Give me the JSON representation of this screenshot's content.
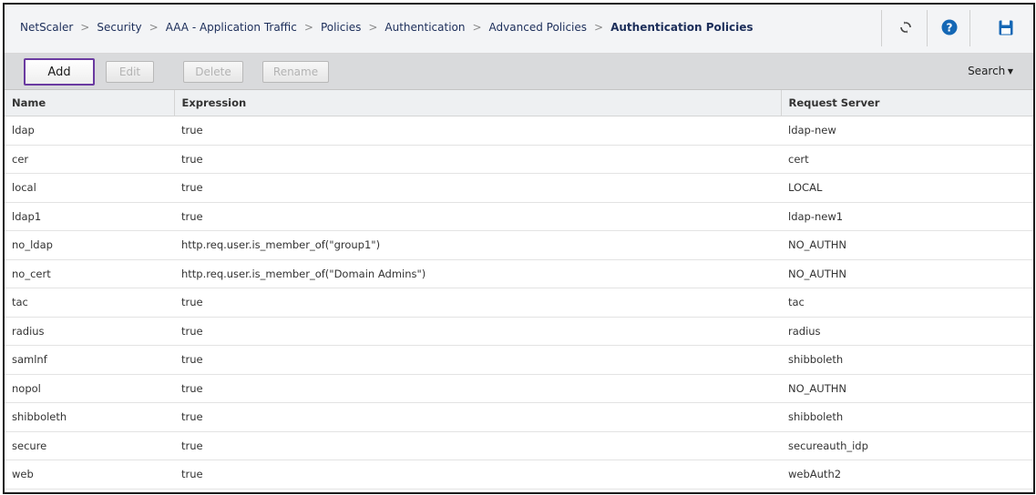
{
  "breadcrumb": [
    "NetScaler",
    "Security",
    "AAA - Application Traffic",
    "Policies",
    "Authentication",
    "Advanced Policies"
  ],
  "breadcrumb_current": "Authentication Policies",
  "header_icons": {
    "refresh": "refresh-icon",
    "help": "help-icon",
    "save": "save-icon"
  },
  "colors": {
    "accent": "#1c2e5a",
    "help_blue": "#1467b5",
    "add_border": "#6a3aa0"
  },
  "toolbar": {
    "add_label": "Add",
    "edit_label": "Edit",
    "delete_label": "Delete",
    "rename_label": "Rename",
    "search_label": "Search"
  },
  "table": {
    "columns": [
      "Name",
      "Expression",
      "Request Server"
    ],
    "rows": [
      [
        "ldap",
        "true",
        "ldap-new"
      ],
      [
        "cer",
        "true",
        "cert"
      ],
      [
        "local",
        "true",
        "LOCAL"
      ],
      [
        "ldap1",
        "true",
        "ldap-new1"
      ],
      [
        "no_ldap",
        "http.req.user.is_member_of(\"group1\")",
        "NO_AUTHN"
      ],
      [
        "no_cert",
        "http.req.user.is_member_of(\"Domain Admins\")",
        "NO_AUTHN"
      ],
      [
        "tac",
        "true",
        "tac"
      ],
      [
        "radius",
        "true",
        "radius"
      ],
      [
        "samlnf",
        "true",
        "shibboleth"
      ],
      [
        "nopol",
        "true",
        "NO_AUTHN"
      ],
      [
        "shibboleth",
        "true",
        "shibboleth"
      ],
      [
        "secure",
        "true",
        "secureauth_idp"
      ],
      [
        "web",
        "true",
        "webAuth2"
      ]
    ]
  }
}
